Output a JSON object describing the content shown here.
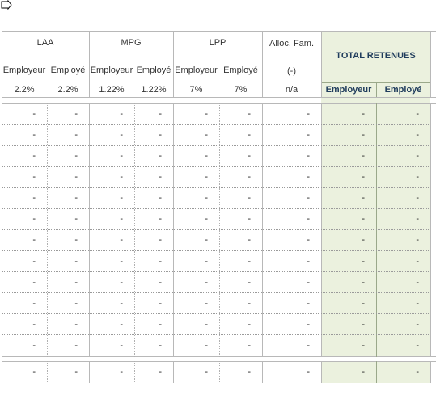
{
  "groups": [
    "LAA",
    "MPG",
    "LPP",
    "Alloc. Fam."
  ],
  "total_title": "TOTAL RETENUES",
  "sub_labels": [
    "Employeur",
    "Employé",
    "Employeur",
    "Employé",
    "Employeur",
    "Employé"
  ],
  "alloc_sub": "(-)",
  "rates": [
    "2.2%",
    "2.2%",
    "1.22%",
    "1.22%",
    "7%",
    "7%",
    "n/a"
  ],
  "total_sub": [
    "Employeur",
    "Employé"
  ],
  "row_count": 12,
  "cell_value": "-",
  "colors": {
    "total_bg": "#ebf1de",
    "header_text": "#1f3c5c"
  }
}
